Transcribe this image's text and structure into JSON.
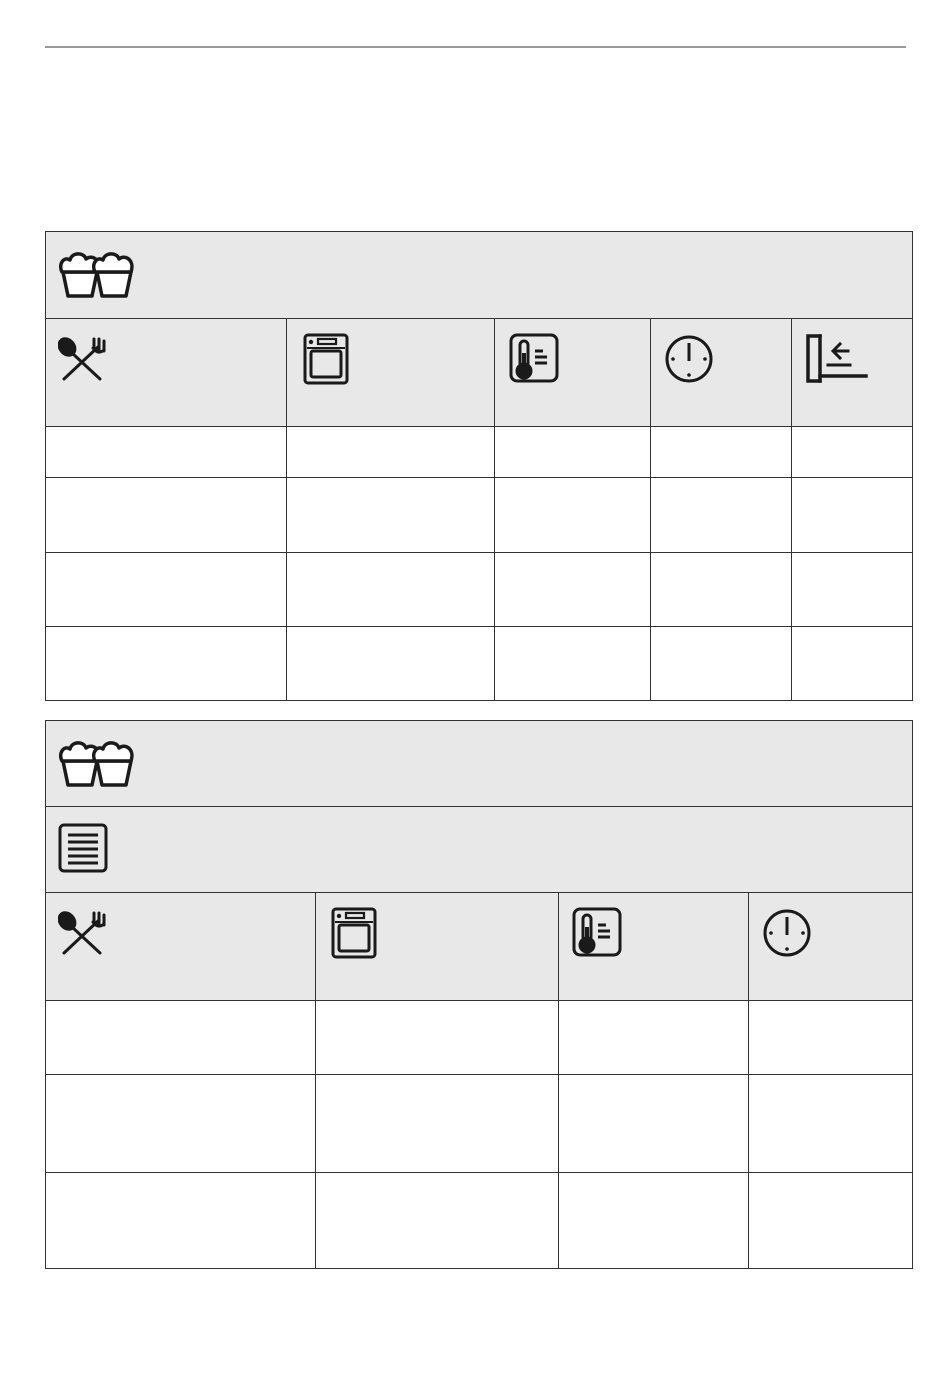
{
  "icons": {
    "bakeware": "cupcakes-icon",
    "food": "spoon-fork-icon",
    "shelf": "oven-shelf-icon",
    "temperature": "thermometer-icon",
    "time": "clock-icon",
    "level": "shelf-level-icon",
    "tray": "baking-tray-icon"
  },
  "table1": {
    "columns": [
      "spoon-fork-icon",
      "oven-shelf-icon",
      "thermometer-icon",
      "clock-icon",
      "shelf-level-icon"
    ],
    "rows": [
      [
        "",
        "",
        "",
        "",
        ""
      ],
      [
        "",
        "",
        "",
        "",
        ""
      ],
      [
        "",
        "",
        "",
        "",
        ""
      ],
      [
        "",
        "",
        "",
        "",
        ""
      ]
    ]
  },
  "table2": {
    "columns": [
      "spoon-fork-icon",
      "oven-shelf-icon",
      "thermometer-icon",
      "clock-icon"
    ],
    "rows": [
      [
        "",
        "",
        "",
        ""
      ],
      [
        "",
        "",
        "",
        ""
      ],
      [
        "",
        "",
        "",
        ""
      ]
    ]
  },
  "colors": {
    "header_band": "#e8e8e8",
    "border": "#333333",
    "rule": "#9a9a9a"
  }
}
